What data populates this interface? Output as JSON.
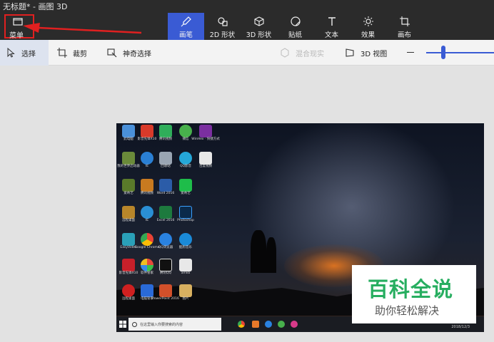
{
  "window": {
    "title": "无标题* - 画图 3D"
  },
  "menu": {
    "label": "菜单"
  },
  "ribbon": {
    "tools": [
      {
        "label": "画笔",
        "icon": "brush-icon",
        "active": true
      },
      {
        "label": "2D 形状",
        "icon": "shapes-2d-icon",
        "active": false
      },
      {
        "label": "3D 形状",
        "icon": "cube-icon",
        "active": false
      },
      {
        "label": "贴纸",
        "icon": "sticker-icon",
        "active": false
      },
      {
        "label": "文本",
        "icon": "text-icon",
        "active": false
      },
      {
        "label": "效果",
        "icon": "effects-icon",
        "active": false
      },
      {
        "label": "画布",
        "icon": "canvas-icon",
        "active": false
      }
    ],
    "active_color": "#3a5bd4"
  },
  "toolbar": {
    "select": "选择",
    "crop": "裁剪",
    "magic_select": "神奇选择",
    "mixed_reality": "混合现实",
    "view_3d": "3D 视图"
  },
  "desktop": {
    "icons": [
      "此电脑",
      "影音先锋X10",
      "腾讯视频",
      "微信",
      "WinHex · 快捷方式",
      "我的世界启动器",
      "IE",
      "回收站",
      "QQ影音",
      "百度视频",
      "爱奇艺",
      "Word 2016",
      "爱奇艺",
      "腾讯视频",
      "Excel 2016",
      "Photoshop",
      "EasyVideo",
      "Google Chrome",
      "QQ浏览器",
      "酷狗音乐",
      "影音先锋X10",
      "软件管家",
      "腾讯QQ",
      "amlib",
      "远程桌面",
      "电脑管家",
      "PowerPoint 2016",
      "图片"
    ],
    "search_placeholder": "在这里输入你要搜索的内容",
    "clock": "2018/12/3"
  },
  "watermark": {
    "top": "百科全说",
    "bottom": "助你轻松解决"
  }
}
